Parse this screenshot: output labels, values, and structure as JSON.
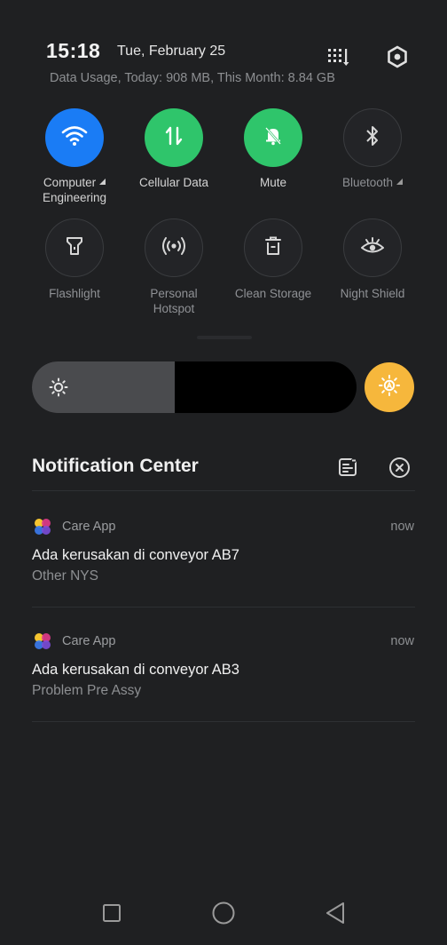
{
  "status": {
    "time": "15:18",
    "date": "Tue, February 25",
    "data_usage": "Data Usage, Today: 908 MB, This Month: 8.84 GB"
  },
  "header_icons": [
    "edit-grid-icon",
    "settings-icon"
  ],
  "tiles": [
    {
      "label_lines": [
        "Computer",
        "Engineering"
      ],
      "icon": "wifi-icon",
      "state": "on",
      "color": "#1a7cf5",
      "has_arrow": true
    },
    {
      "label_lines": [
        "Cellular Data"
      ],
      "icon": "cellular-data-icon",
      "state": "on",
      "color": "#2fc56b",
      "has_arrow": false
    },
    {
      "label_lines": [
        "Mute"
      ],
      "icon": "mute-bell-icon",
      "state": "on",
      "color": "#2fc56b",
      "has_arrow": false
    },
    {
      "label_lines": [
        "Bluetooth"
      ],
      "icon": "bluetooth-icon",
      "state": "off",
      "has_arrow": true
    },
    {
      "label_lines": [
        "Flashlight"
      ],
      "icon": "flashlight-icon",
      "state": "off"
    },
    {
      "label_lines": [
        "Personal",
        "Hotspot"
      ],
      "icon": "hotspot-icon",
      "state": "off"
    },
    {
      "label_lines": [
        "Clean Storage"
      ],
      "icon": "trash-icon",
      "state": "off"
    },
    {
      "label_lines": [
        "Night Shield"
      ],
      "icon": "eye-icon",
      "state": "off"
    }
  ],
  "brightness": {
    "level": 0.44,
    "auto_enabled": true,
    "auto_color": "#f6b73c"
  },
  "notification_center": {
    "title": "Notification Center",
    "icons": [
      "manage-notifications-icon",
      "clear-all-icon"
    ]
  },
  "notifications": [
    {
      "app": "Care App",
      "time": "now",
      "title": "Ada kerusakan di conveyor AB7",
      "subtitle": "Other NYS"
    },
    {
      "app": "Care App",
      "time": "now",
      "title": "Ada kerusakan di conveyor AB3",
      "subtitle": "Problem Pre Assy"
    }
  ],
  "navbar": [
    "recents-square-icon",
    "home-circle-icon",
    "back-triangle-icon"
  ]
}
